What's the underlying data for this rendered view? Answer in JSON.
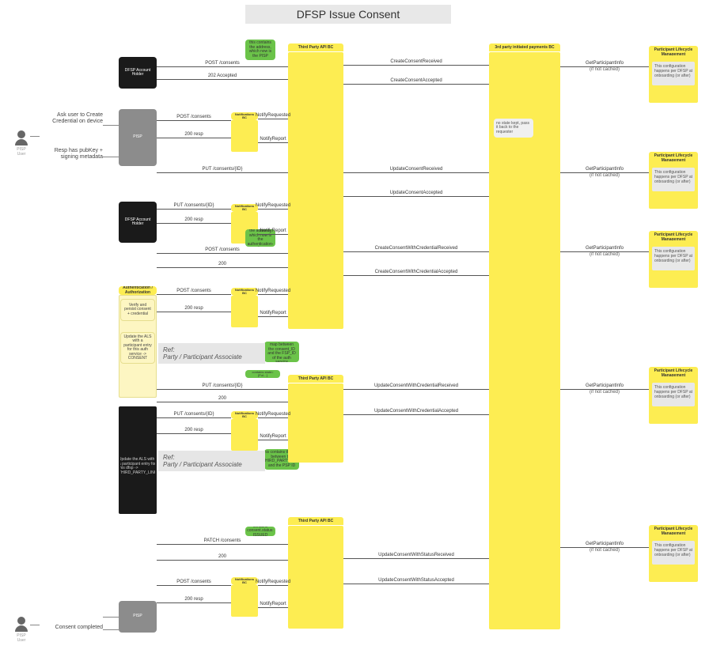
{
  "title": "DFSP Issue Consent",
  "actors": {
    "user_top": "PISP User",
    "user_bottom": "PISP User"
  },
  "side_notes": {
    "create_cred": "Ask user to Create Credential on device",
    "resp_pubkey": "Resp has pubKey + signing metadata",
    "consent_done": "Consent completed"
  },
  "participants": {
    "dfsp_holder1": "DFSP Account Holder",
    "pisp": "PISP",
    "dfsp_holder2": "DFSP Account Holder",
    "auth": "Authentication / Authorization",
    "third_party_api": "Third Party API BC",
    "third_party_payments": "3rd party initiated payments BC",
    "lifecycle": "Participant Lifecycle Management"
  },
  "green_notes": {
    "g1": "this contains the address, which now is the PISP",
    "g2": "this contains the address, which now is the authentication-bc",
    "g3": "this contains the map between the consent_ID and the FSP_ID of the auth service",
    "g4": "this contains the map between the THIRD_PARTY_LINK and the PSP ID",
    "g5": "contains state=[Ful…]",
    "g6": "contains consent.status: ISSUED"
  },
  "yellow_notes": {
    "notif1": "Notifications BC",
    "notif2": "Notifications BC",
    "notif3": "Notifications BC",
    "notif4": "Notifications BC",
    "notif5": "Notifications BC"
  },
  "cream_notes": {
    "auth1": "Verify and persist consent + credential",
    "auth2": "Update the ALS with a participant entry for this auth service -> CONSENT",
    "black1": "Update the ALS with a participant entry for this dfsp -> THIRD_PARTY_LINK"
  },
  "grey_notes": {
    "tpp_note": "no state kept, pass it back to the requester",
    "lifecycle_note": "This configuration happens per DFSP at onboarding (or after)"
  },
  "messages": {
    "post_consents": "POST /consents",
    "accepted_202": "202 Accepted",
    "resp_200": "200 resp",
    "code_200": "200",
    "put_consents_id": "PUT /consents/{ID}",
    "patch_consents": "PATCH /consents",
    "notify_req": "NotifyRequested",
    "notify_rep": "NotifyReport",
    "create_consent_recv": "CreateConsentReceived",
    "create_consent_acc": "CreateConsentAccepted",
    "update_consent_recv": "UpdateConsentReceived",
    "update_consent_acc": "UpdateConsentAccepted",
    "create_cred_recv": "CreateConsentWithCredentialReceived",
    "create_cred_acc": "CreateConsentWithCredentialAccepted",
    "update_cred_recv": "UpdateConsentWithCredentialReceived",
    "update_cred_acc": "UpdateConsentWithCredentialAccepted",
    "update_status_recv": "UpdateConsentWithStatusReceived",
    "update_status_acc": "UpdateConsentWithStatusAccepted",
    "get_participant": "GetParticipantInfo",
    "if_not_cached": "(if not cached)"
  },
  "refs": {
    "ref1": "Ref:\nParty / Participant Associate",
    "ref2": "Ref:\nParty / Participant Associate"
  }
}
